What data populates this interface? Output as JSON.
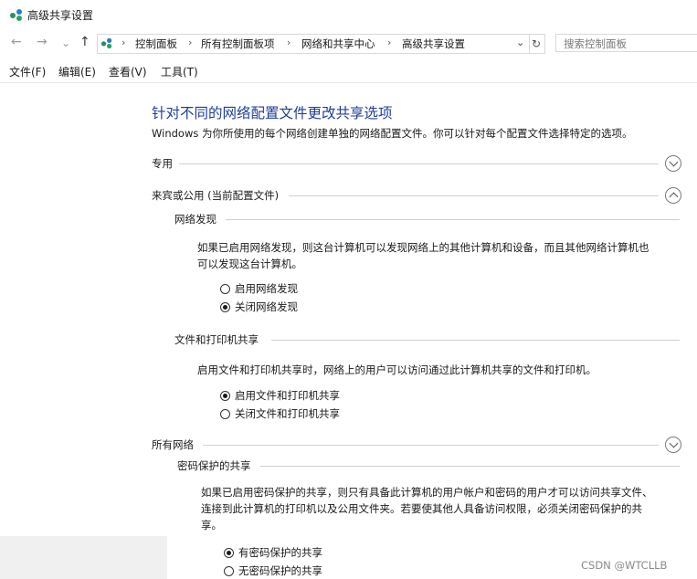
{
  "window": {
    "title": "高级共享设置"
  },
  "nav": {
    "back": "←",
    "forward": "→",
    "recent": "⌄",
    "up": "↑",
    "breadcrumbs": [
      "控制面板",
      "所有控制面板项",
      "网络和共享中心",
      "高级共享设置"
    ],
    "separator": "›",
    "refresh": "↻",
    "search_placeholder": "搜索控制面板"
  },
  "menu": [
    "文件(F)",
    "编辑(E)",
    "查看(V)",
    "工具(T)"
  ],
  "content": {
    "heading": "针对不同的网络配置文件更改共享选项",
    "description": "Windows 为你所使用的每个网络创建单独的网络配置文件。你可以针对每个配置文件选择特定的选项。",
    "profiles": {
      "private": {
        "label": "专用",
        "expanded": false
      },
      "guest": {
        "label": "来宾或公用 (当前配置文件)",
        "expanded": true
      },
      "all": {
        "label": "所有网络",
        "expanded": false
      }
    },
    "network_discovery": {
      "title": "网络发现",
      "text_line1": "如果已启用网络发现，则这台计算机可以发现网络上的其他计算机和设备，而且其他网络计算机也",
      "text_line2": "可以发现这台计算机。",
      "options": [
        "启用网络发现",
        "关闭网络发现"
      ],
      "selected": 1
    },
    "file_printer": {
      "title": "文件和打印机共享",
      "text": "启用文件和打印机共享时，网络上的用户可以访问通过此计算机共享的文件和打印机。",
      "options": [
        "启用文件和打印机共享",
        "关闭文件和打印机共享"
      ],
      "selected": 0
    },
    "password_sharing": {
      "title": "密码保护的共享",
      "text_line1": "如果已启用密码保护的共享，则只有具备此计算机的用户帐户和密码的用户才可以访问共享文件、",
      "text_line2": "连接到此计算机的打印机以及公用文件夹。若要使其他人具备访问权限，必须关闭密码保护的共",
      "text_line3": "享。",
      "options": [
        "有密码保护的共享",
        "无密码保护的共享"
      ],
      "selected": 0
    }
  },
  "watermark": "CSDN @WTCLLB",
  "colors": {
    "heading": "#1f3d99",
    "left_pane": "#f0f0f0"
  }
}
